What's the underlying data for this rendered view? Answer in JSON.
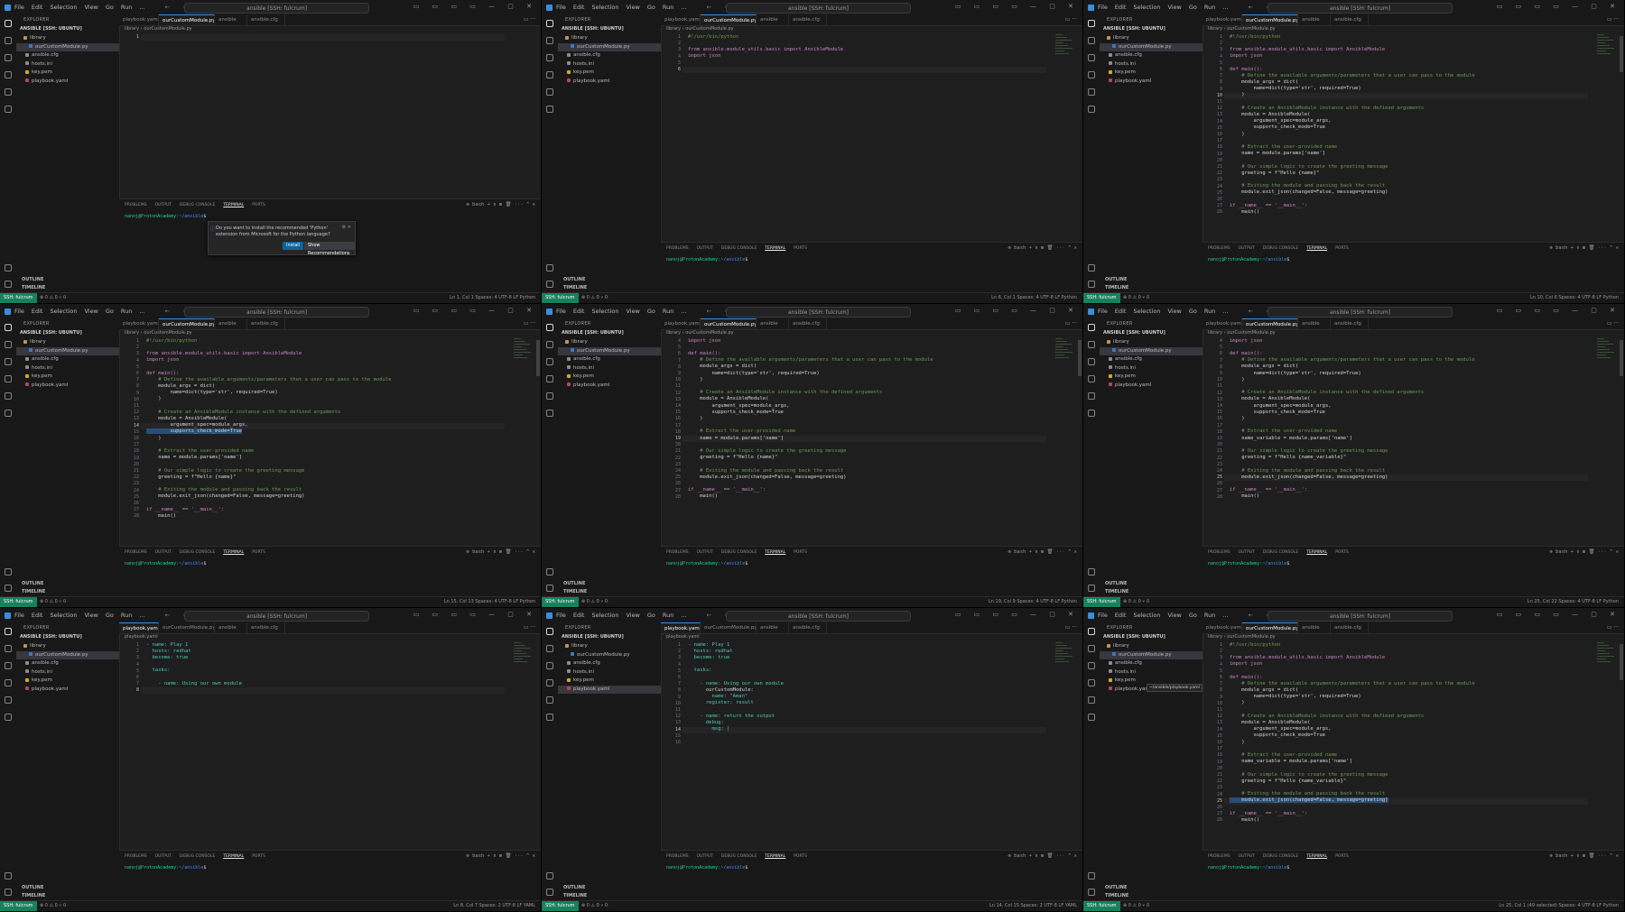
{
  "app": {
    "menu": [
      "File",
      "Edit",
      "Selection",
      "View",
      "Go",
      "Run",
      "..."
    ],
    "search": "ansible [SSH: fulcrum]",
    "explorer_title": "EXPLORER",
    "project": "ANSIBLE [SSH: UBUNTU]",
    "outline": "OUTLINE",
    "timeline": "TIMELINE",
    "remote": "SSH: fulcrum",
    "status_left": "⊗ 0 ⚠ 0   ⑂ 0",
    "crumb_module": "library › ourCustomModule.py",
    "crumb_playbook": "playbook.yaml",
    "panel_tabs": [
      "PROBLEMS",
      "OUTPUT",
      "DEBUG CONSOLE",
      "TERMINAL",
      "PORTS"
    ],
    "panel_ctl": "⊕ bash + ∨ ⊞ 🗑 ··· ^ ✕",
    "prompt_user": "nanoj@ProtonAcademy",
    "prompt_path": ":~/ansible",
    "prompt_end": "$",
    "colors": {
      "accent": "#3a8de0",
      "remote": "#16825d",
      "comment": "#6a9955",
      "keyword": "#c586c0",
      "string": "#ce9178"
    }
  },
  "notification": {
    "text": "Do you want to install the recommended 'Python' extension from Microsoft for the Python language?",
    "install": "Install",
    "show": "Show Recommendations",
    "icon": "info-icon"
  },
  "panels": [
    {
      "sidebar_sel": 1,
      "sidebar_rows": [
        "library",
        "ourCustomModule.py",
        "ansible.cfg",
        "hosts.ini",
        "key.pem",
        "playbook.yaml"
      ],
      "tabs": [
        "playbook.yaml",
        "ourCustomModule.py",
        "ansible",
        "ansible.cfg"
      ],
      "active_tab": 1,
      "lines": [
        [
          "1",
          ""
        ]
      ],
      "cur": 0,
      "panel_h": 80,
      "notify": true,
      "status_right": "Ln 1, Col 1   Spaces: 4   UTF-8   LF   Python"
    },
    {
      "sidebar_sel": 1,
      "sidebar_rows": [
        "library",
        "ourCustomModule.py",
        "ansible.cfg",
        "hosts.ini",
        "key.pem",
        "playbook.yaml"
      ],
      "tabs": [
        "playbook.yaml",
        "ourCustomModule.py",
        "ansible",
        "ansible.cfg"
      ],
      "active_tab": 1,
      "lines": [
        [
          "1",
          "#!/usr/bin/python"
        ],
        [
          "2",
          ""
        ],
        [
          "3",
          "from ansible.module_utils.basic import AnsibleModule"
        ],
        [
          "4",
          "import json"
        ],
        [
          "5",
          ""
        ],
        [
          "6",
          ""
        ]
      ],
      "cur": 5,
      "panel_h": 32,
      "notify": false,
      "status_right": "Ln 6, Col 1   Spaces: 4   UTF-8   LF   Python"
    },
    {
      "sidebar_sel": 1,
      "sidebar_rows": [
        "library",
        "ourCustomModule.py",
        "ansible.cfg",
        "hosts.ini",
        "key.pem",
        "playbook.yaml"
      ],
      "tabs": [
        "playbook.yaml",
        "ourCustomModule.py",
        "ansible",
        "ansible.cfg"
      ],
      "active_tab": 1,
      "lines": [
        [
          "1",
          "#!/usr/bin/python"
        ],
        [
          "2",
          ""
        ],
        [
          "3",
          "from ansible.module_utils.basic import AnsibleModule"
        ],
        [
          "4",
          "import json"
        ],
        [
          "5",
          ""
        ],
        [
          "6",
          "def main():"
        ],
        [
          "7",
          "    # Define the available arguments/parameters that a user can pass to the module"
        ],
        [
          "8",
          "    module_args = dict("
        ],
        [
          "9",
          "        name=dict(type='str', required=True)"
        ],
        [
          "10",
          "    )"
        ],
        [
          "11",
          ""
        ],
        [
          "12",
          "    # Create an AnsibleModule instance with the defined arguments"
        ],
        [
          "13",
          "    module = AnsibleModule("
        ],
        [
          "14",
          "        argument_spec=module_args,"
        ],
        [
          "15",
          "        supports_check_mode=True"
        ],
        [
          "16",
          "    )"
        ],
        [
          "17",
          ""
        ],
        [
          "18",
          "    # Extract the user-provided name"
        ],
        [
          "19",
          "    name = module.params['name']"
        ],
        [
          "20",
          ""
        ],
        [
          "21",
          "    # Our simple logic to create the greeting message"
        ],
        [
          "22",
          "    greeting = f\"Hello {name}\""
        ],
        [
          "23",
          ""
        ],
        [
          "24",
          "    # Exiting the module and passing back the result"
        ],
        [
          "25",
          "    module.exit_json(changed=False, message=greeting)"
        ],
        [
          "26",
          ""
        ],
        [
          "27",
          "if __name__ == '__main__':"
        ],
        [
          "28",
          "    main()"
        ]
      ],
      "cur": 9,
      "panel_h": 32,
      "notify": false,
      "status_right": "Ln 10, Col 6   Spaces: 4   UTF-8   LF   Python"
    },
    {
      "sidebar_sel": 1,
      "sidebar_rows": [
        "library",
        "ourCustomModule.py",
        "ansible.cfg",
        "hosts.ini",
        "key.pem",
        "playbook.yaml"
      ],
      "tabs": [
        "playbook.yaml",
        "ourCustomModule.py",
        "ansible",
        "ansible.cfg"
      ],
      "active_tab": 1,
      "lines": [
        [
          "1",
          "#!/usr/bin/python"
        ],
        [
          "2",
          ""
        ],
        [
          "3",
          "from ansible.module_utils.basic import AnsibleModule"
        ],
        [
          "4",
          "import json"
        ],
        [
          "5",
          ""
        ],
        [
          "6",
          "def main():"
        ],
        [
          "7",
          "    # Define the available arguments/parameters that a user can pass to the module"
        ],
        [
          "8",
          "    module_args = dict("
        ],
        [
          "9",
          "        name=dict(type='str', required=True)"
        ],
        [
          "10",
          "    )"
        ],
        [
          "11",
          ""
        ],
        [
          "12",
          "    # Create an AnsibleModule instance with the defined arguments"
        ],
        [
          "13",
          "    module = AnsibleModule("
        ],
        [
          "14",
          "        argument_spec=module_args,"
        ],
        [
          "15",
          "        supports_check_mode=True"
        ],
        [
          "16",
          "    )"
        ],
        [
          "17",
          ""
        ],
        [
          "18",
          "    # Extract the user-provided name"
        ],
        [
          "19",
          "    name = module.params['name']"
        ],
        [
          "20",
          ""
        ],
        [
          "21",
          "    # Our simple logic to create the greeting message"
        ],
        [
          "22",
          "    greeting = f\"Hello {name}\""
        ],
        [
          "23",
          ""
        ],
        [
          "24",
          "    # Exiting the module and passing back the result"
        ],
        [
          "25",
          "    module.exit_json(changed=False, message=greeting)"
        ],
        [
          "26",
          ""
        ],
        [
          "27",
          "if __name__ == '__main__':"
        ],
        [
          "28",
          "    main()"
        ]
      ],
      "cur": 13,
      "hl": 14,
      "panel_h": 32,
      "notify": false,
      "status_right": "Ln 15, Col 13   Spaces: 4   UTF-8   LF   Python"
    },
    {
      "sidebar_sel": 1,
      "sidebar_rows": [
        "library",
        "ourCustomModule.py",
        "ansible.cfg",
        "hosts.ini",
        "key.pem",
        "playbook.yaml"
      ],
      "tabs": [
        "playbook.yaml",
        "ourCustomModule.py",
        "ansible",
        "ansible.cfg"
      ],
      "active_tab": 1,
      "lines": [
        [
          "4",
          "import json"
        ],
        [
          "5",
          ""
        ],
        [
          "6",
          "def main():"
        ],
        [
          "7",
          "    # Define the available arguments/parameters that a user can pass to the module"
        ],
        [
          "8",
          "    module_args = dict("
        ],
        [
          "9",
          "        name=dict(type='str', required=True)"
        ],
        [
          "10",
          "    )"
        ],
        [
          "11",
          ""
        ],
        [
          "12",
          "    # Create an AnsibleModule instance with the defined arguments"
        ],
        [
          "13",
          "    module = AnsibleModule("
        ],
        [
          "14",
          "        argument_spec=module_args,"
        ],
        [
          "15",
          "        supports_check_mode=True"
        ],
        [
          "16",
          "    )"
        ],
        [
          "17",
          ""
        ],
        [
          "18",
          "    # Extract the user-provided name"
        ],
        [
          "19",
          "    name = module.params['name']"
        ],
        [
          "20",
          ""
        ],
        [
          "21",
          "    # Our simple logic to create the greeting message"
        ],
        [
          "22",
          "    greeting = f\"Hello {name}\""
        ],
        [
          "23",
          ""
        ],
        [
          "24",
          "    # Exiting the module and passing back the result"
        ],
        [
          "25",
          "    module.exit_json(changed=False, message=greeting)"
        ],
        [
          "26",
          ""
        ],
        [
          "27",
          "if __name__ == '__main__':"
        ],
        [
          "28",
          "    main()"
        ]
      ],
      "cur": 15,
      "panel_h": 32,
      "notify": false,
      "status_right": "Ln 19, Col 9   Spaces: 4   UTF-8   LF   Python"
    },
    {
      "sidebar_sel": 1,
      "sidebar_rows": [
        "library",
        "ourCustomModule.py",
        "ansible.cfg",
        "hosts.ini",
        "key.pem",
        "playbook.yaml"
      ],
      "tabs": [
        "playbook.yaml",
        "ourCustomModule.py",
        "ansible",
        "ansible.cfg"
      ],
      "active_tab": 1,
      "lines": [
        [
          "4",
          "import json"
        ],
        [
          "5",
          ""
        ],
        [
          "6",
          "def main():"
        ],
        [
          "7",
          "    # Define the available arguments/parameters that a user can pass to the module"
        ],
        [
          "8",
          "    module_args = dict("
        ],
        [
          "9",
          "        name=dict(type='str', required=True)"
        ],
        [
          "10",
          "    )"
        ],
        [
          "11",
          ""
        ],
        [
          "12",
          "    # Create an AnsibleModule instance with the defined arguments"
        ],
        [
          "13",
          "    module = AnsibleModule("
        ],
        [
          "14",
          "        argument_spec=module_args,"
        ],
        [
          "15",
          "        supports_check_mode=True"
        ],
        [
          "16",
          "    )"
        ],
        [
          "17",
          ""
        ],
        [
          "18",
          "    # Extract the user-provided name"
        ],
        [
          "19",
          "    name_variable = module.params['name']"
        ],
        [
          "20",
          ""
        ],
        [
          "21",
          "    # Our simple logic to create the greeting message"
        ],
        [
          "22",
          "    greeting = f\"Hello {name_variable}\""
        ],
        [
          "23",
          ""
        ],
        [
          "24",
          "    # Exiting the module and passing back the result"
        ],
        [
          "25",
          "    module.exit_json(changed=False, message=greeting)"
        ],
        [
          "26",
          ""
        ],
        [
          "27",
          "if __name__ == '__main__':"
        ],
        [
          "28",
          "    main()"
        ]
      ],
      "cur": 21,
      "panel_h": 32,
      "notify": false,
      "status_right": "Ln 25, Col 22   Spaces: 4   UTF-8   LF   Python"
    },
    {
      "sidebar_sel": 1,
      "sidebar_rows": [
        "library",
        "ourCustomModule.py",
        "ansible.cfg",
        "hosts.ini",
        "key.pem",
        "playbook.yaml"
      ],
      "tabs": [
        "playbook.yaml",
        "ourCustomModule.py",
        "ansible",
        "ansible.cfg"
      ],
      "active_tab": 0,
      "lines": [
        [
          "1",
          "- name: Play 1"
        ],
        [
          "2",
          "  hosts: redhat"
        ],
        [
          "3",
          "  become: true"
        ],
        [
          "4",
          ""
        ],
        [
          "5",
          "  tasks:"
        ],
        [
          "6",
          ""
        ],
        [
          "7",
          "    - name: Using our own module"
        ],
        [
          "8",
          ""
        ]
      ],
      "cur": 7,
      "panel_h": 32,
      "notify": false,
      "status_right": "Ln 8, Col 7   Spaces: 2   UTF-8   LF   YAML"
    },
    {
      "sidebar_sel": 5,
      "sidebar_rows": [
        "library",
        "ourCustomModule.py",
        "ansible.cfg",
        "hosts.ini",
        "key.pem",
        "playbook.yaml"
      ],
      "tabs": [
        "playbook.yaml",
        "ourCustomModule.py",
        "ansible",
        "ansible.cfg"
      ],
      "active_tab": 0,
      "lines": [
        [
          "1",
          "- name: Play 1"
        ],
        [
          "2",
          "  hosts: redhat"
        ],
        [
          "3",
          "  become: true"
        ],
        [
          "4",
          ""
        ],
        [
          "5",
          "  tasks:"
        ],
        [
          "6",
          ""
        ],
        [
          "7",
          "    - name: Using our own module"
        ],
        [
          "8",
          "      ourCustomModule:"
        ],
        [
          "9",
          "        name: \"Aman\""
        ],
        [
          "10",
          "      register: result"
        ],
        [
          "11",
          ""
        ],
        [
          "12",
          "    - name: return the output"
        ],
        [
          "13",
          "      debug:"
        ],
        [
          "14",
          "        msg: |"
        ],
        [
          "15",
          ""
        ],
        [
          "16",
          ""
        ]
      ],
      "cur": 13,
      "panel_h": 32,
      "notify": false,
      "status_right": "Ln 14, Col 15   Spaces: 2   UTF-8   LF   YAML"
    },
    {
      "sidebar_sel": 1,
      "sidebar_rows": [
        "library",
        "ourCustomModule.py",
        "ansible.cfg",
        "hosts.ini",
        "key.pem",
        "playbook.yaml"
      ],
      "tabs": [
        "playbook.yaml",
        "ourCustomModule.py",
        "ansible",
        "ansible.cfg"
      ],
      "active_tab": 1,
      "lines": [
        [
          "1",
          "#!/usr/bin/python"
        ],
        [
          "2",
          ""
        ],
        [
          "3",
          "from ansible.module_utils.basic import AnsibleModule"
        ],
        [
          "4",
          "import json"
        ],
        [
          "5",
          ""
        ],
        [
          "6",
          "def main():"
        ],
        [
          "7",
          "    # Define the available arguments/parameters that a user can pass to the module"
        ],
        [
          "8",
          "    module_args = dict("
        ],
        [
          "9",
          "        name=dict(type='str', required=True)"
        ],
        [
          "10",
          "    )"
        ],
        [
          "11",
          ""
        ],
        [
          "12",
          "    # Create an AnsibleModule instance with the defined arguments"
        ],
        [
          "13",
          "    module = AnsibleModule("
        ],
        [
          "14",
          "        argument_spec=module_args,"
        ],
        [
          "15",
          "        supports_check_mode=True"
        ],
        [
          "16",
          "    )"
        ],
        [
          "17",
          ""
        ],
        [
          "18",
          "    # Extract the user-provided name"
        ],
        [
          "19",
          "    name_variable = module.params['name']"
        ],
        [
          "20",
          ""
        ],
        [
          "21",
          "    # Our simple logic to create the greeting message"
        ],
        [
          "22",
          "    greeting = f\"Hello {name_variable}\""
        ],
        [
          "23",
          ""
        ],
        [
          "24",
          "    # Exiting the module and passing back the result"
        ],
        [
          "25",
          "    module.exit_json(changed=False, message=greeting)"
        ],
        [
          "26",
          ""
        ],
        [
          "27",
          "if __name__ == '__main__':"
        ],
        [
          "28",
          "    main()"
        ]
      ],
      "cur": 24,
      "hl": 24,
      "panel_h": 32,
      "notify": false,
      "tooltip": "~/ansible/playbook.yaml",
      "status_right": "Ln 25, Col 1 (49 selected)   Spaces: 4   UTF-8   LF   Python"
    }
  ]
}
